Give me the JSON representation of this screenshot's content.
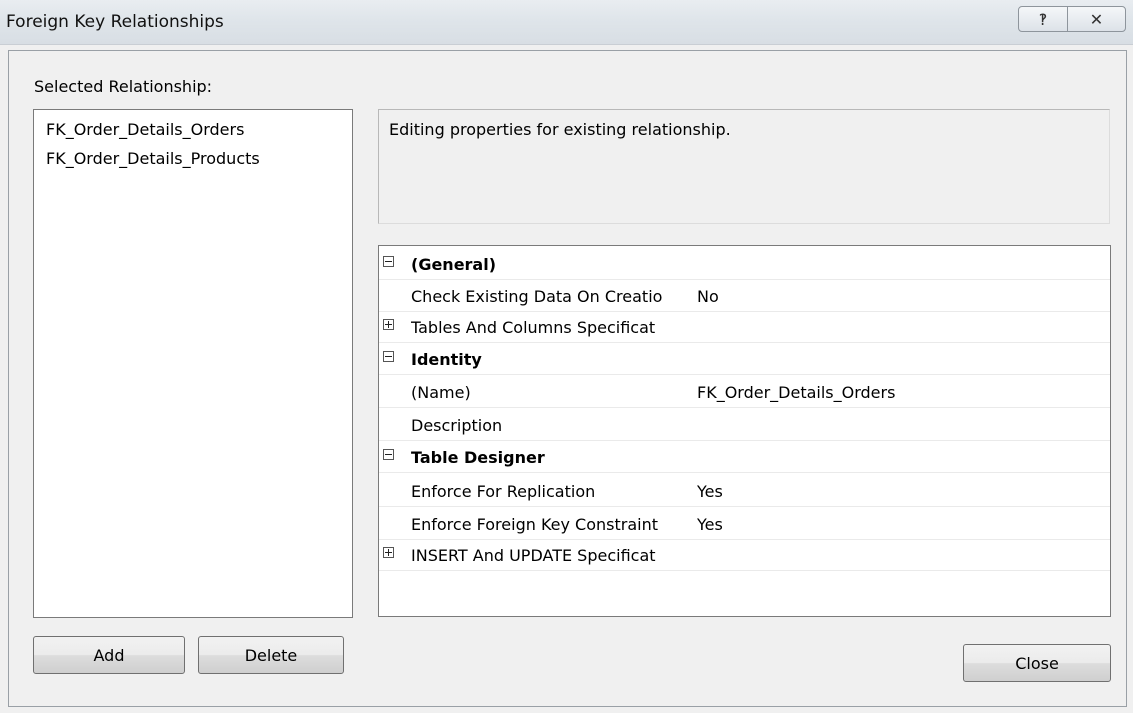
{
  "window": {
    "title": "Foreign Key Relationships",
    "help_icon": "help-icon",
    "close_icon": "close-icon"
  },
  "selected_relationship": {
    "label": "Selected Relationship:",
    "items": [
      "FK_Order_Details_Orders",
      "FK_Order_Details_Products"
    ]
  },
  "description": "Editing properties for existing relationship.",
  "properties": [
    {
      "type": "category",
      "label": "(General)",
      "expanded": true
    },
    {
      "type": "property",
      "name": "Check Existing Data On Creatio",
      "value": "No"
    },
    {
      "type": "property",
      "name": "Tables And Columns Specificat",
      "value": "",
      "expandable": true
    },
    {
      "type": "category",
      "label": "Identity",
      "expanded": true
    },
    {
      "type": "property",
      "name": "(Name)",
      "value": "FK_Order_Details_Orders"
    },
    {
      "type": "property",
      "name": "Description",
      "value": ""
    },
    {
      "type": "category",
      "label": "Table Designer",
      "expanded": true
    },
    {
      "type": "property",
      "name": "Enforce For Replication",
      "value": "Yes"
    },
    {
      "type": "property",
      "name": "Enforce Foreign Key Constraint",
      "value": "Yes"
    },
    {
      "type": "property",
      "name": "INSERT And UPDATE Specificat",
      "value": "",
      "expandable": true
    }
  ],
  "buttons": {
    "add": "Add",
    "delete": "Delete",
    "close": "Close"
  }
}
